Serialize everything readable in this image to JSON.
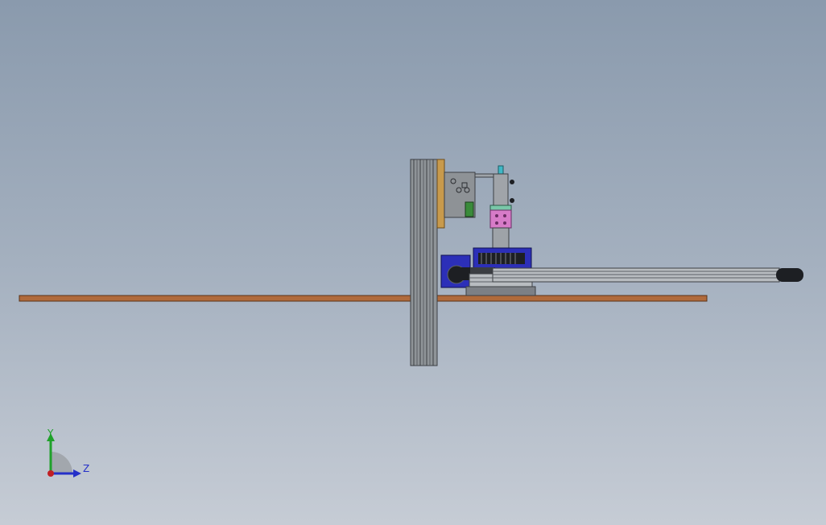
{
  "view": {
    "triad": {
      "y_label": "Y",
      "z_label": "Z"
    }
  },
  "colors": {
    "background_top": "#8a9aad",
    "background_bottom": "#c6ccd5",
    "floor_plate": "#b06a3b",
    "column": "#8f9498",
    "column_edge": "#3c3f44",
    "gearbox_blue": "#2c2fb8",
    "camera_pink": "#d77bc8",
    "bracket_tan": "#c89a4c",
    "arm_gray": "#b8bcc0",
    "cable_black": "#1d1f23",
    "axis_y": "#1fa12a",
    "axis_z": "#2530c8",
    "axis_origin": "#c11f24"
  },
  "icons": {
    "triad": "coordinate-triad-icon"
  }
}
